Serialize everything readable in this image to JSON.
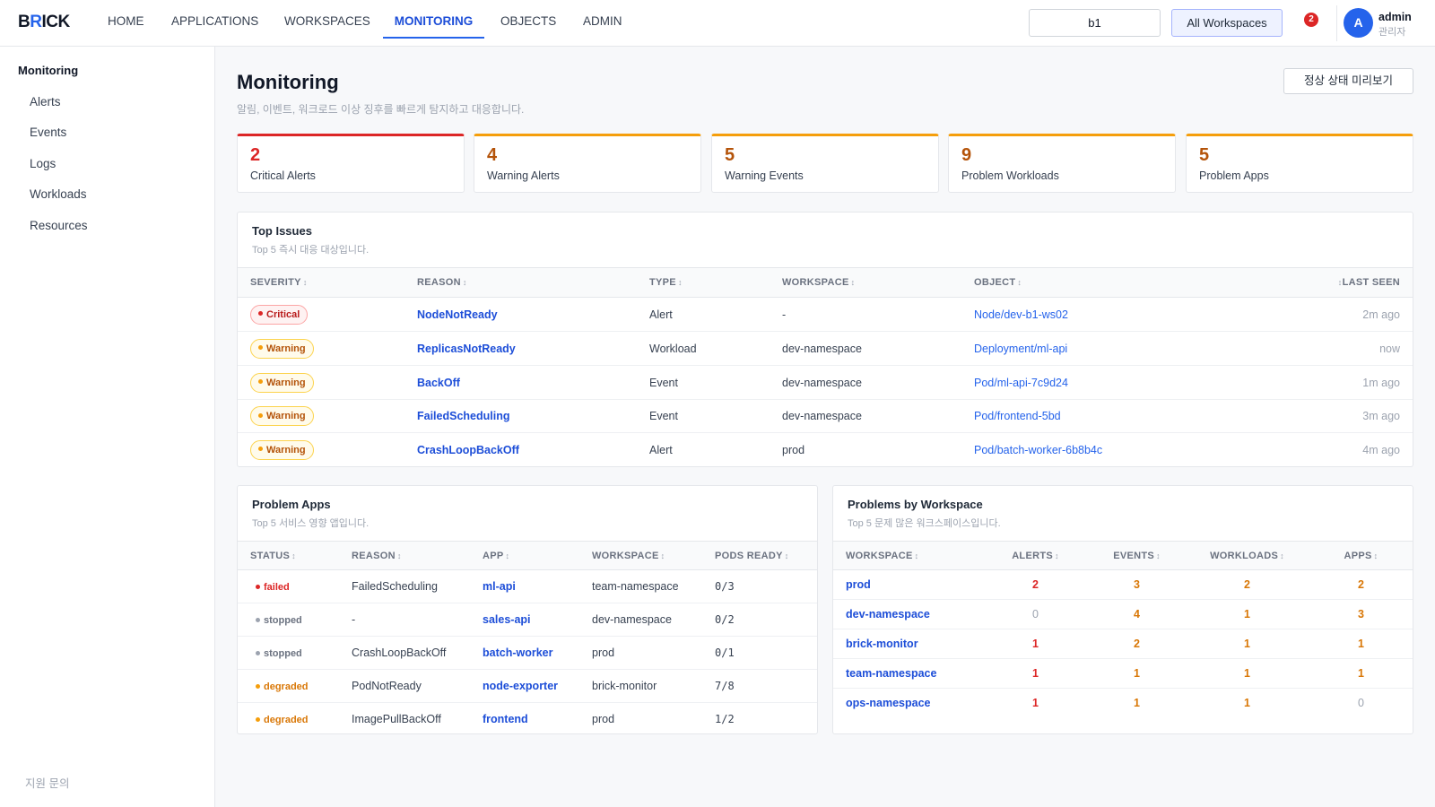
{
  "brand": {
    "b": "B",
    "r": "R",
    "rest": "ICK"
  },
  "nav": {
    "items": [
      {
        "id": "home",
        "label": "HOME"
      },
      {
        "id": "applications",
        "label": "APPLICATIONS"
      },
      {
        "id": "workspaces",
        "label": "WORKSPACES"
      },
      {
        "id": "monitoring",
        "label": "MONITORING",
        "active": true
      },
      {
        "id": "objects",
        "label": "OBJECTS"
      },
      {
        "id": "admin",
        "label": "ADMIN"
      }
    ],
    "search_value": "b1",
    "workspace_button": "All Workspaces",
    "notification_count": "2",
    "user": {
      "initial": "A",
      "name": "admin",
      "role": "관리자"
    }
  },
  "sidebar": {
    "title": "Monitoring",
    "items": [
      "Alerts",
      "Events",
      "Logs",
      "Workloads",
      "Resources"
    ],
    "footer": "지원 문의"
  },
  "page": {
    "title": "Monitoring",
    "subtitle": "알림, 이벤트, 워크로드 이상 징후를 빠르게 탐지하고 대응합니다.",
    "preview_button": "정상 상태 미리보기"
  },
  "stats": [
    {
      "value": "2",
      "label": "Critical Alerts",
      "level": "critical"
    },
    {
      "value": "4",
      "label": "Warning Alerts",
      "level": "warning"
    },
    {
      "value": "5",
      "label": "Warning Events",
      "level": "warning"
    },
    {
      "value": "9",
      "label": "Problem Workloads",
      "level": "warning"
    },
    {
      "value": "5",
      "label": "Problem Apps",
      "level": "warning"
    }
  ],
  "top_issues": {
    "title": "Top Issues",
    "subtitle": "Top 5 즉시 대응 대상입니다.",
    "columns": [
      "SEVERITY",
      "REASON",
      "TYPE",
      "WORKSPACE",
      "OBJECT",
      "LAST SEEN"
    ],
    "rows": [
      {
        "severity": "Critical",
        "level": "crit",
        "reason": "NodeNotReady",
        "type": "Alert",
        "workspace": "-",
        "object": "Node/dev-b1-ws02",
        "last_seen": "2m ago"
      },
      {
        "severity": "Warning",
        "level": "warn",
        "reason": "ReplicasNotReady",
        "type": "Workload",
        "workspace": "dev-namespace",
        "object": "Deployment/ml-api",
        "last_seen": "now"
      },
      {
        "severity": "Warning",
        "level": "warn",
        "reason": "BackOff",
        "type": "Event",
        "workspace": "dev-namespace",
        "object": "Pod/ml-api-7c9d24",
        "last_seen": "1m ago"
      },
      {
        "severity": "Warning",
        "level": "warn",
        "reason": "FailedScheduling",
        "type": "Event",
        "workspace": "dev-namespace",
        "object": "Pod/frontend-5bd",
        "last_seen": "3m ago"
      },
      {
        "severity": "Warning",
        "level": "warn",
        "reason": "CrashLoopBackOff",
        "type": "Alert",
        "workspace": "prod",
        "object": "Pod/batch-worker-6b8b4c",
        "last_seen": "4m ago"
      }
    ]
  },
  "problem_apps": {
    "title": "Problem Apps",
    "subtitle": "Top 5 서비스 영향 앱입니다.",
    "columns": [
      "STATUS",
      "REASON",
      "APP",
      "WORKSPACE",
      "PODS READY"
    ],
    "rows": [
      {
        "status": "failed",
        "reason": "FailedScheduling",
        "app": "ml-api",
        "workspace": "team-namespace",
        "pods": "0/3"
      },
      {
        "status": "stopped",
        "reason": "-",
        "app": "sales-api",
        "workspace": "dev-namespace",
        "pods": "0/2"
      },
      {
        "status": "stopped",
        "reason": "CrashLoopBackOff",
        "app": "batch-worker",
        "workspace": "prod",
        "pods": "0/1"
      },
      {
        "status": "degraded",
        "reason": "PodNotReady",
        "app": "node-exporter",
        "workspace": "brick-monitor",
        "pods": "7/8"
      },
      {
        "status": "degraded",
        "reason": "ImagePullBackOff",
        "app": "frontend",
        "workspace": "prod",
        "pods": "1/2"
      }
    ]
  },
  "problems_by_workspace": {
    "title": "Problems by Workspace",
    "subtitle": "Top 5 문제 많은 워크스페이스입니다.",
    "columns": [
      "WORKSPACE",
      "ALERTS",
      "EVENTS",
      "WORKLOADS",
      "APPS"
    ],
    "rows": [
      {
        "workspace": "prod",
        "alerts": "2",
        "events": "3",
        "workloads": "2",
        "apps": "2"
      },
      {
        "workspace": "dev-namespace",
        "alerts": "0",
        "events": "4",
        "workloads": "1",
        "apps": "3"
      },
      {
        "workspace": "brick-monitor",
        "alerts": "1",
        "events": "2",
        "workloads": "1",
        "apps": "1"
      },
      {
        "workspace": "team-namespace",
        "alerts": "1",
        "events": "1",
        "workloads": "1",
        "apps": "1"
      },
      {
        "workspace": "ops-namespace",
        "alerts": "1",
        "events": "1",
        "workloads": "1",
        "apps": "0"
      }
    ]
  },
  "colors": {
    "accent": "#2563eb",
    "critical": "#dc2626",
    "warning": "#f59e0b"
  }
}
